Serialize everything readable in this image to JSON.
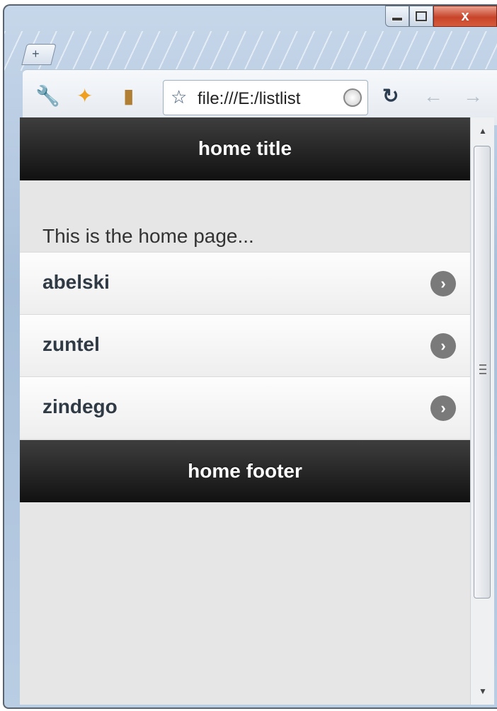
{
  "browser": {
    "caption": {
      "minimize": "–",
      "close": "x"
    },
    "new_tab_icon": "+",
    "toolbar": {
      "url": "file:///E:/listlist",
      "icons": [
        "wrench-icon",
        "star-extension-icon",
        "clipboard-icon",
        "bookmark-star-icon",
        "globe-icon",
        "reload-icon",
        "back-arrow-icon",
        "forward-arrow-icon"
      ]
    }
  },
  "page": {
    "header_title": "home title",
    "content_text": "This is the home page...",
    "list_items": [
      {
        "label": "abelski"
      },
      {
        "label": "zuntel"
      },
      {
        "label": "zindego"
      }
    ],
    "footer_title": "home footer"
  },
  "colors": {
    "bar_background": "#111111",
    "page_background": "#e6e6e6",
    "list_arrow": "#7a7a7a"
  }
}
